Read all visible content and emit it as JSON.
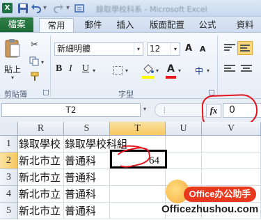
{
  "title_bar": {
    "title": "錄取學校科系 - Microsoft Excel"
  },
  "ribbon_tabs": {
    "file": "檔案",
    "home": "常用",
    "mailings": "郵件",
    "insert": "插入",
    "page_layout": "版面配置",
    "formulas": "公式",
    "data": "資料"
  },
  "clipboard": {
    "paste_label": "貼上",
    "group_label": "剪貼簿"
  },
  "font": {
    "name": "新細明體",
    "size": "12",
    "bold": "B",
    "italic": "I",
    "underline": "U",
    "font_color_glyph": "A",
    "phonetic_glyph": "中",
    "grow_glyph": "A",
    "shrink_glyph": "A",
    "group_label": "字型",
    "fill_color": "#ffff00",
    "font_color": "#e81919"
  },
  "formula_bar": {
    "name_box": "T2",
    "fx_label": "fx",
    "value": "0"
  },
  "grid": {
    "columns": [
      "R",
      "S",
      "T",
      "U",
      "V"
    ],
    "selected_column": "T",
    "rows": [
      {
        "num": "1",
        "R": "錄取學校",
        "S": "錄取學校科組",
        "T": "",
        "U": "",
        "V": ""
      },
      {
        "num": "2",
        "R": "新北市立",
        "S": "普通科",
        "T": "64",
        "U": "",
        "V": ""
      },
      {
        "num": "3",
        "R": "新北市立",
        "S": "普通科",
        "T": "",
        "U": "",
        "V": ""
      },
      {
        "num": "4",
        "R": "新北市立",
        "S": "普通科",
        "T": "",
        "U": "",
        "V": ""
      },
      {
        "num": "5",
        "R": "新北市立",
        "S": "普通科",
        "T": "",
        "U": "",
        "V": ""
      }
    ],
    "selected_row": "2"
  },
  "watermark": {
    "badge": "Office办公助手",
    "url": "Officezhushou.com"
  },
  "colors": {
    "file_tab": "#1d6a36",
    "annotation_red": "#e4141b",
    "selection_header": "#f6c75f"
  }
}
